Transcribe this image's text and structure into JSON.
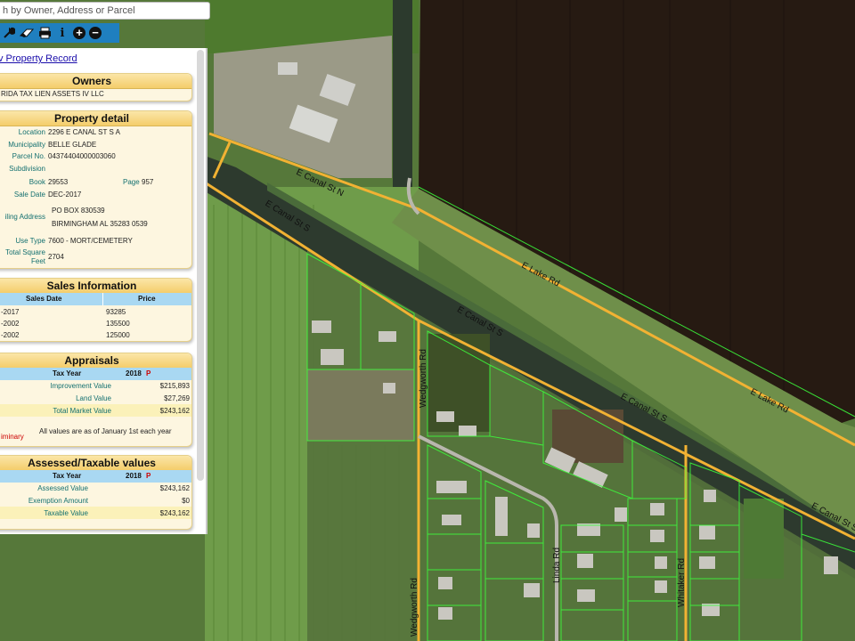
{
  "search": {
    "placeholder": "h by Owner, Address or Parcel"
  },
  "toolbar": {
    "icons": [
      "wrench-icon",
      "eraser-icon",
      "print-icon",
      "info-icon",
      "zoom-in-icon",
      "zoom-out-icon"
    ],
    "info_glyph": "i",
    "zoom_in_glyph": "+",
    "zoom_out_glyph": "−"
  },
  "panel": {
    "link": "v Property Record",
    "owners": {
      "title": "Owners",
      "name": "RIDA TAX LIEN ASSETS IV LLC"
    },
    "detail": {
      "title": "Property detail",
      "location_label": "Location",
      "location": "2296 E CANAL ST S A",
      "municipality_label": "Municipality",
      "municipality": "BELLE GLADE",
      "parcel_label": "Parcel No.",
      "parcel": "04374404000003060",
      "subdivision_label": "Subdivision",
      "book_label": "Book",
      "book": "29553",
      "page_label": "Page",
      "page": "957",
      "sale_date_label": "Sale Date",
      "sale_date": "DEC-2017",
      "mailing_label": "iling Address",
      "mailing_1": "PO BOX 830539",
      "mailing_2": "BIRMINGHAM AL 35283 0539",
      "use_type_label": "Use Type",
      "use_type": "7600 - MORT/CEMETERY",
      "total_sq_label_1": "Total Square",
      "total_sq_label_2": "Feet",
      "total_sq": "2704"
    },
    "sales": {
      "title": "Sales Information",
      "col_date": "Sales Date",
      "col_price": "Price",
      "rows": [
        {
          "date": "-2017",
          "price": "93285"
        },
        {
          "date": "-2002",
          "price": "135500"
        },
        {
          "date": "-2002",
          "price": "125000"
        }
      ]
    },
    "appraisals": {
      "title": "Appraisals",
      "col_year": "Tax Year",
      "year": "2018",
      "flag": "P",
      "improvement_label": "Improvement Value",
      "improvement": "$215,893",
      "land_label": "Land Value",
      "land": "$27,269",
      "total_label": "Total Market Value",
      "total": "$243,162",
      "prelim": "iminary",
      "note": "All values are as of January 1st each year"
    },
    "assessed": {
      "title": "Assessed/Taxable values",
      "col_year": "Tax Year",
      "year": "2018",
      "flag": "P",
      "assessed_label": "Assessed Value",
      "assessed": "$243,162",
      "exemption_label": "Exemption Amount",
      "exemption": "$0",
      "taxable_label": "Taxable Value",
      "taxable": "$243,162"
    }
  },
  "map": {
    "labels": {
      "canal_n": "E Canal St N",
      "canal_s_1": "E Canal St S",
      "canal_s_2": "E Canal St S",
      "canal_s_3": "E Canal St S",
      "canal_s_4": "E Canal St S",
      "lake_1": "E Lake Rd",
      "lake_2": "E Lake Rd",
      "wedgworth_1": "Wedgworth Rd",
      "wedgworth_2": "Wedgworth Rd",
      "linda": "Linda Rd",
      "whitaker": "Whitaker Rd"
    },
    "colors": {
      "road": "#f2b233",
      "parcel": "#3cff3c",
      "field": "#2e1f14",
      "canal": "#2d3a2e",
      "grass": "#5f8a3c"
    }
  }
}
